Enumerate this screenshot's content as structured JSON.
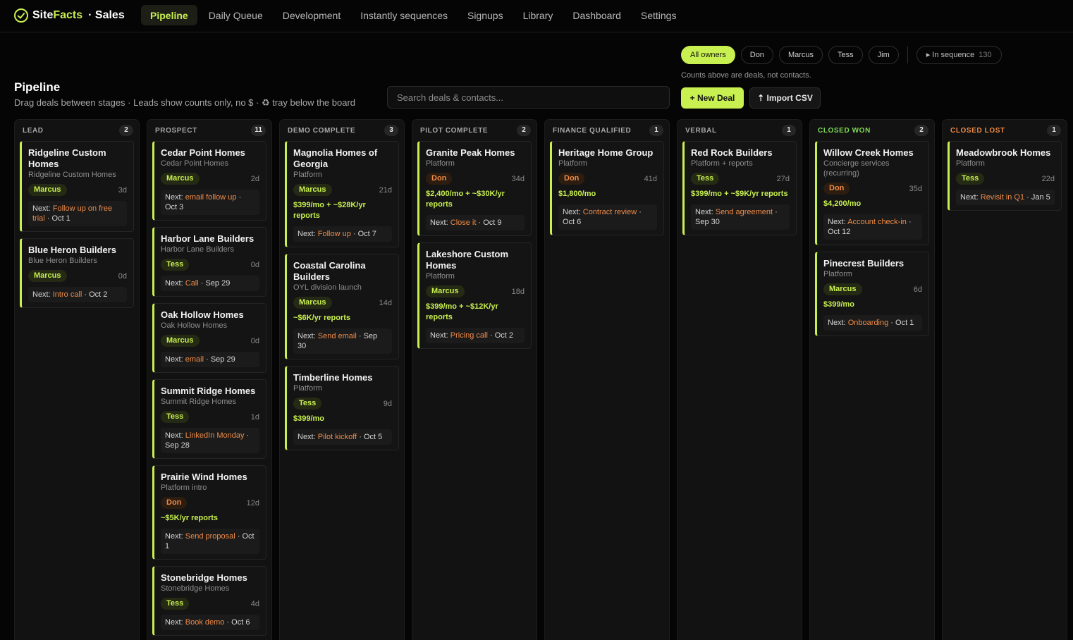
{
  "brand": {
    "name_site": "Site",
    "name_facts": "Facts",
    "section": "· Sales",
    "icon": "check-circle-icon"
  },
  "nav": [
    {
      "label": "Pipeline",
      "active": true
    },
    {
      "label": "Daily Queue"
    },
    {
      "label": "Development"
    },
    {
      "label": "Instantly sequences"
    },
    {
      "label": "Signups"
    },
    {
      "label": "Library"
    },
    {
      "label": "Dashboard"
    },
    {
      "label": "Settings"
    }
  ],
  "owners": {
    "filters": [
      "All owners",
      "Don",
      "Marcus",
      "Tess",
      "Jim"
    ],
    "sequence_label": "▸ In sequence",
    "sequence_count": "130",
    "note": "Counts above are deals, not contacts."
  },
  "header": {
    "title": "Pipeline",
    "subtitle": "Drag deals between stages · Leads show counts only, no $ · ♻ tray below the board",
    "search_placeholder": "Search deals & contacts...",
    "new_deal": "+ New Deal",
    "import_csv": "⇡ Import CSV"
  },
  "colors": {
    "accent": "#c8f050",
    "don": "#ef8b48",
    "won": "#7ed957",
    "lost": "#ef8b48"
  },
  "columns": [
    {
      "title": "LEAD",
      "count": "2",
      "cards": [
        {
          "title": "Ridgeline Custom Homes",
          "sub": "Ridgeline Custom Homes",
          "owner": "Marcus",
          "age": "3d",
          "next_label": "Next:",
          "next_action": "Follow up on free trial",
          "next_date": " · Oct 1"
        },
        {
          "title": "Blue Heron Builders",
          "sub": "Blue Heron Builders",
          "owner": "Marcus",
          "age": "0d",
          "next_label": "Next:",
          "next_action": "Intro call",
          "next_date": " · Oct 2"
        }
      ]
    },
    {
      "title": "PROSPECT",
      "count": "11",
      "cards": [
        {
          "title": "Cedar Point Homes",
          "sub": "Cedar Point Homes",
          "owner": "Marcus",
          "age": "2d",
          "next_label": "Next:",
          "next_action": "email follow up",
          "next_date": " · Oct 3"
        },
        {
          "title": "Harbor Lane Builders",
          "sub": "Harbor Lane Builders",
          "owner": "Tess",
          "age": "0d",
          "next_label": "Next:",
          "next_action": "Call",
          "next_date": " · Sep 29"
        },
        {
          "title": "Oak Hollow Homes",
          "sub": "Oak Hollow Homes",
          "owner": "Marcus",
          "age": "0d",
          "next_label": "Next:",
          "next_action": "email",
          "next_date": " · Sep 29"
        },
        {
          "title": "Summit Ridge Homes",
          "sub": "Summit Ridge Homes",
          "owner": "Tess",
          "age": "1d",
          "next_label": "Next:",
          "next_action": "LinkedIn Monday",
          "next_date": " · Sep 28"
        },
        {
          "title": "Prairie Wind Homes",
          "sub": "Platform intro",
          "owner": "Don",
          "age": "12d",
          "value": "~$5K/yr reports",
          "next_label": "Next:",
          "next_action": "Send proposal",
          "next_date": " · Oct 1"
        },
        {
          "title": "Stonebridge Homes",
          "sub": "Stonebridge Homes",
          "owner": "Tess",
          "age": "4d",
          "next_label": "Next:",
          "next_action": "Book demo",
          "next_date": " · Oct 6"
        }
      ]
    },
    {
      "title": "DEMO COMPLETE",
      "count": "3",
      "cards": [
        {
          "title": "Magnolia Homes of Georgia",
          "sub": "Platform",
          "owner": "Marcus",
          "age": "21d",
          "value": "$399/mo + ~$28K/yr reports",
          "next_label": "Next:",
          "next_action": "Follow up",
          "next_date": " · Oct 7"
        },
        {
          "title": "Coastal Carolina Builders",
          "sub": "OYL division launch",
          "owner": "Marcus",
          "age": "14d",
          "value": "~$6K/yr reports",
          "next_label": "Next:",
          "next_action": "Send email",
          "next_date": " · Sep 30"
        },
        {
          "title": "Timberline Homes",
          "sub": "Platform",
          "owner": "Tess",
          "age": "9d",
          "value": "$399/mo",
          "next_label": "Next:",
          "next_action": "Pilot kickoff",
          "next_date": " · Oct 5"
        }
      ]
    },
    {
      "title": "PILOT COMPLETE",
      "count": "2",
      "cards": [
        {
          "title": "Granite Peak Homes",
          "sub": "Platform",
          "owner": "Don",
          "age": "34d",
          "value": "$2,400/mo + ~$30K/yr reports",
          "next_label": "Next:",
          "next_action": "Close it",
          "next_date": " · Oct 9"
        },
        {
          "title": "Lakeshore Custom Homes",
          "sub": "Platform",
          "owner": "Marcus",
          "age": "18d",
          "value": "$399/mo + ~$12K/yr reports",
          "next_label": "Next:",
          "next_action": "Pricing call",
          "next_date": " · Oct 2"
        }
      ]
    },
    {
      "title": "FINANCE QUALIFIED",
      "count": "1",
      "cards": [
        {
          "title": "Heritage Home Group",
          "sub": "Platform",
          "owner": "Don",
          "age": "41d",
          "value": "$1,800/mo",
          "next_label": "Next:",
          "next_action": "Contract review",
          "next_date": " · Oct 6"
        }
      ]
    },
    {
      "title": "VERBAL",
      "count": "1",
      "cards": [
        {
          "title": "Red Rock Builders",
          "sub": "Platform + reports",
          "owner": "Tess",
          "age": "27d",
          "value": "$399/mo + ~$9K/yr reports",
          "next_label": "Next:",
          "next_action": "Send agreement",
          "next_date": " · Sep 30"
        }
      ]
    },
    {
      "title": "CLOSED WON",
      "count": "2",
      "tone": "won",
      "cards": [
        {
          "title": "Willow Creek Homes",
          "sub": "Concierge services (recurring)",
          "owner": "Don",
          "age": "35d",
          "value": "$4,200/mo",
          "next_label": "Next:",
          "next_action": "Account check-in",
          "next_date": " · Oct 12"
        },
        {
          "title": "Pinecrest Builders",
          "sub": "Platform",
          "owner": "Marcus",
          "age": "6d",
          "value": "$399/mo",
          "next_label": "Next:",
          "next_action": "Onboarding",
          "next_date": " · Oct 1"
        }
      ]
    },
    {
      "title": "CLOSED LOST",
      "count": "1",
      "tone": "lost",
      "cards": [
        {
          "title": "Meadowbrook Homes",
          "sub": "Platform",
          "owner": "Tess",
          "age": "22d",
          "next_label": "Next:",
          "next_action": "Revisit in Q1",
          "next_date": " · Jan 5"
        }
      ]
    }
  ]
}
